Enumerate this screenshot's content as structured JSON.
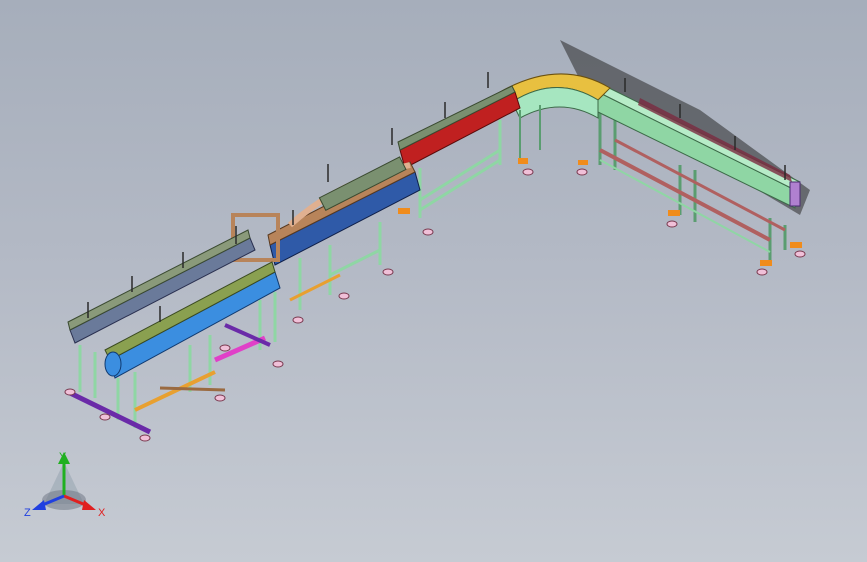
{
  "viewport": {
    "background_top": "#a6aebb",
    "background_bottom": "#c6cbd3"
  },
  "model": {
    "description_colors": {
      "frame": "#8fd6a4",
      "frame_dark": "#5a9d70",
      "belt_blue": "#3b8ee0",
      "belt_navy": "#2f5aa8",
      "red_section": "#c02020",
      "tan_section": "#b8845a",
      "curve_green": "#a6e6c0",
      "curve_yellow": "#e8c040",
      "orange_feet": "#f08c1c",
      "purple_base": "#6a2aa8",
      "magenta_beam": "#e040c8",
      "brown_beam": "#9a6a40",
      "olive": "#8aa050"
    }
  },
  "triad": {
    "x_label": "X",
    "y_label": "Y",
    "z_label": "Z",
    "x_color": "#e02020",
    "y_color": "#20b020",
    "z_color": "#2040e0"
  }
}
